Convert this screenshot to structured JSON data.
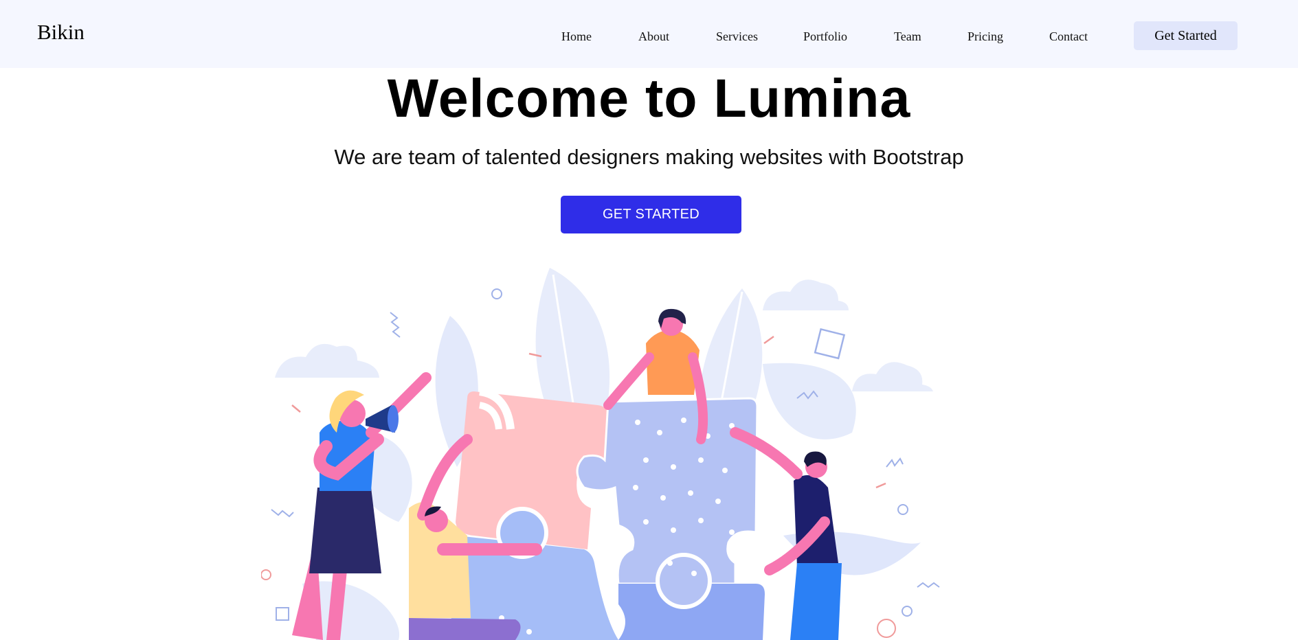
{
  "navbar": {
    "brand": "Bikin",
    "links": [
      "Home",
      "About",
      "Services",
      "Portfolio",
      "Team",
      "Pricing",
      "Contact"
    ],
    "cta_label": "Get Started"
  },
  "hero": {
    "title": "Welcome to Lumina",
    "subtitle": "We are team of talented designers making websites with Bootstrap",
    "button_label": "GET STARTED"
  },
  "colors": {
    "navbar_bg": "#f5f7ff",
    "cta_bg": "#e1e6fb",
    "primary": "#2f2de8"
  },
  "illustration": {
    "icon": "team-puzzle-illustration"
  }
}
